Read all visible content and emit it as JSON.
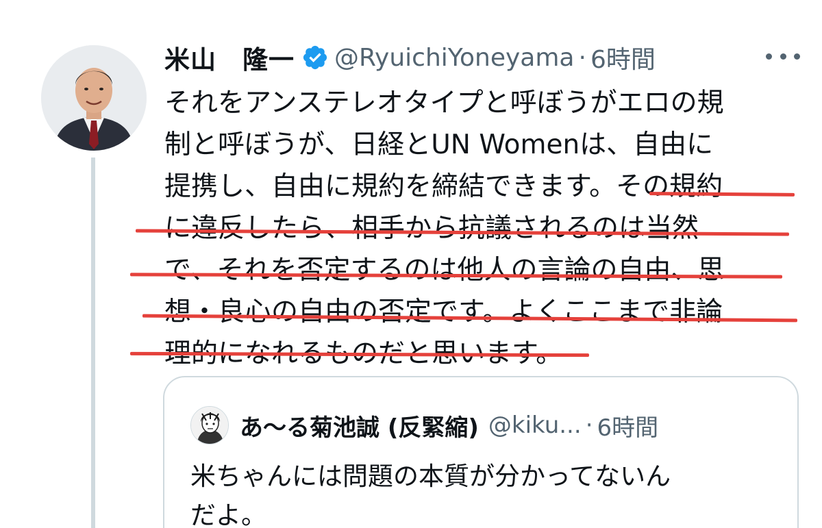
{
  "tweet": {
    "author": {
      "display_name": "米山　隆一",
      "handle": "@RyuichiYoneyama",
      "verified": true,
      "avatar_icon": "profile-photo-man-in-suit"
    },
    "separator": "·",
    "time": "6時間",
    "more_icon": "more-horizontal-icon",
    "text_lines": [
      "それをアンステレオタイプと呼ぼうがエロの規",
      "制と呼ぼうが、日経とUN Womenは、自由に",
      "提携し、自由に規約を締結できます。その規約",
      "に違反したら、相手から抗議されるのは当然",
      "で、それを否定するのは他人の言論の自由、思",
      "想・良心の自由の否定です。よくここまで非論",
      "理的になれるものだと思います。"
    ],
    "annotation_color": "#e5413b"
  },
  "quoted_tweet": {
    "author": {
      "display_name": "あ〜る菊池誠 (反緊縮)",
      "handle": "@kiku...",
      "avatar_icon": "manga-character-avatar"
    },
    "separator": "·",
    "time": "6時間",
    "text_lines": [
      "米ちゃんには問題の本質が分かってないん",
      "だよ。"
    ]
  },
  "colors": {
    "text_primary": "#0f1419",
    "text_secondary": "#536471",
    "verified_blue": "#1d9bf0",
    "border": "#cfd9de"
  }
}
